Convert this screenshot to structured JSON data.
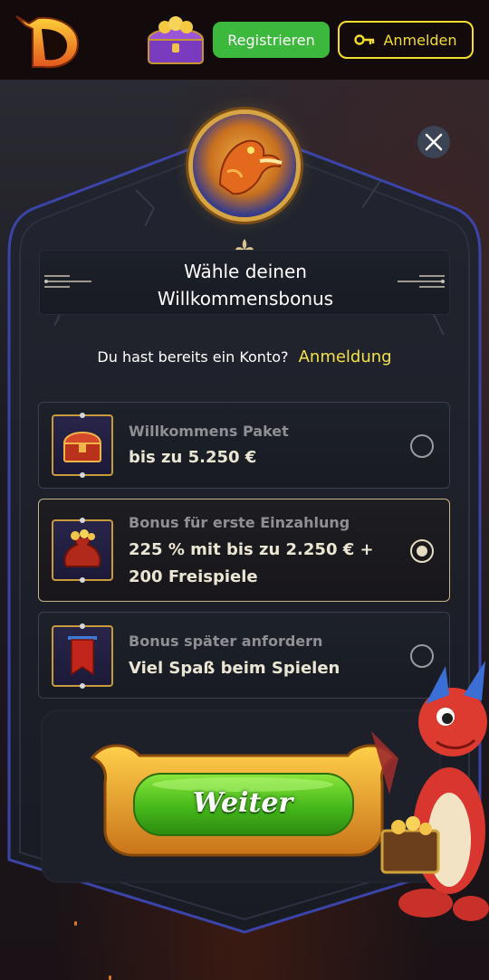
{
  "header": {
    "logo_icon": "dragon-d-logo",
    "promo_icon": "treasure-chest-icon",
    "register_label": "Registrieren",
    "login_label": "Anmelden",
    "login_icon": "key-icon",
    "colors": {
      "register": "#3cb83c",
      "login_accent": "#f3dd2d"
    }
  },
  "modal": {
    "title_line1": "Wähle deinen",
    "title_line2": "Willkommensbonus",
    "account_question": "Du hast bereits ein Konto?",
    "account_link": "Anmeldung",
    "close_icon": "close-icon",
    "emblem_icon": "fire-dragon-emblem-icon",
    "options": [
      {
        "title": "Willkommens Paket",
        "value": "bis zu 5.250 €",
        "icon": "treasure-chest-icon",
        "selected": false
      },
      {
        "title": "Bonus für erste Einzahlung",
        "value": "225 % mit bis zu 2.250 € + 200 Freispiele",
        "icon": "money-bag-icon",
        "selected": true
      },
      {
        "title": "Bonus später anfordern",
        "value": "Viel Spaß beim Spielen",
        "icon": "banner-flag-icon",
        "selected": false
      }
    ],
    "continue_label": "Weiter",
    "colors": {
      "link": "#f3e24a",
      "selected_border": "#c8b58a",
      "cta_green": "#4cc21c",
      "cta_gold": "#e8a424"
    }
  }
}
